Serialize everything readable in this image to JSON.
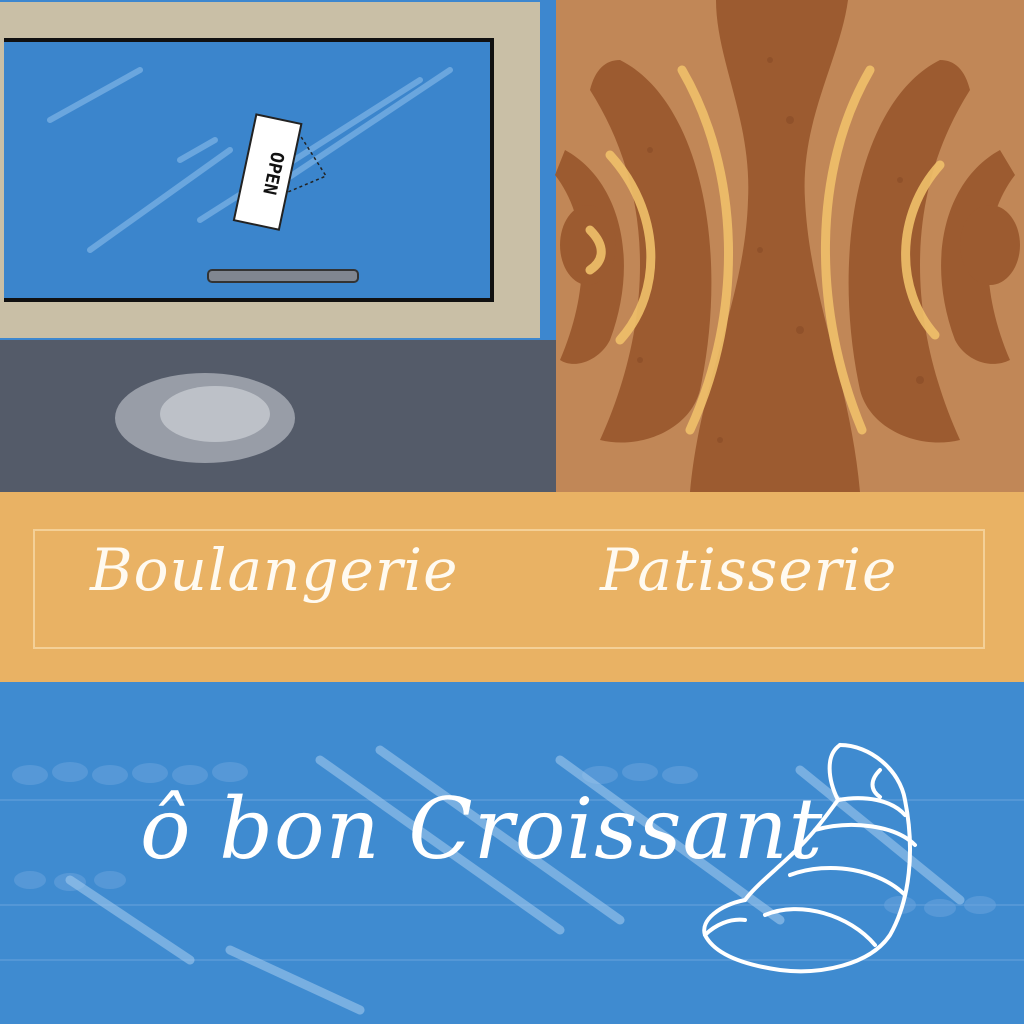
{
  "scene": {
    "open_sign_text": "OPEN",
    "sign_words": [
      "Boulangerie",
      "Patisserie"
    ],
    "brand": "ô bon Croissant"
  },
  "colors": {
    "sky_blue": "#3d87cf",
    "frame_beige": "#c9bfa6",
    "asphalt": "#545b69",
    "pastry_bg": "#c18757",
    "pastry_dark": "#8c4f25",
    "pastry_light": "#f0c06a",
    "sign_orange": "#e9b264",
    "display_blue": "#3f8bd0",
    "ink_white": "#ffffff"
  },
  "icons": [
    "croissant-icon"
  ]
}
